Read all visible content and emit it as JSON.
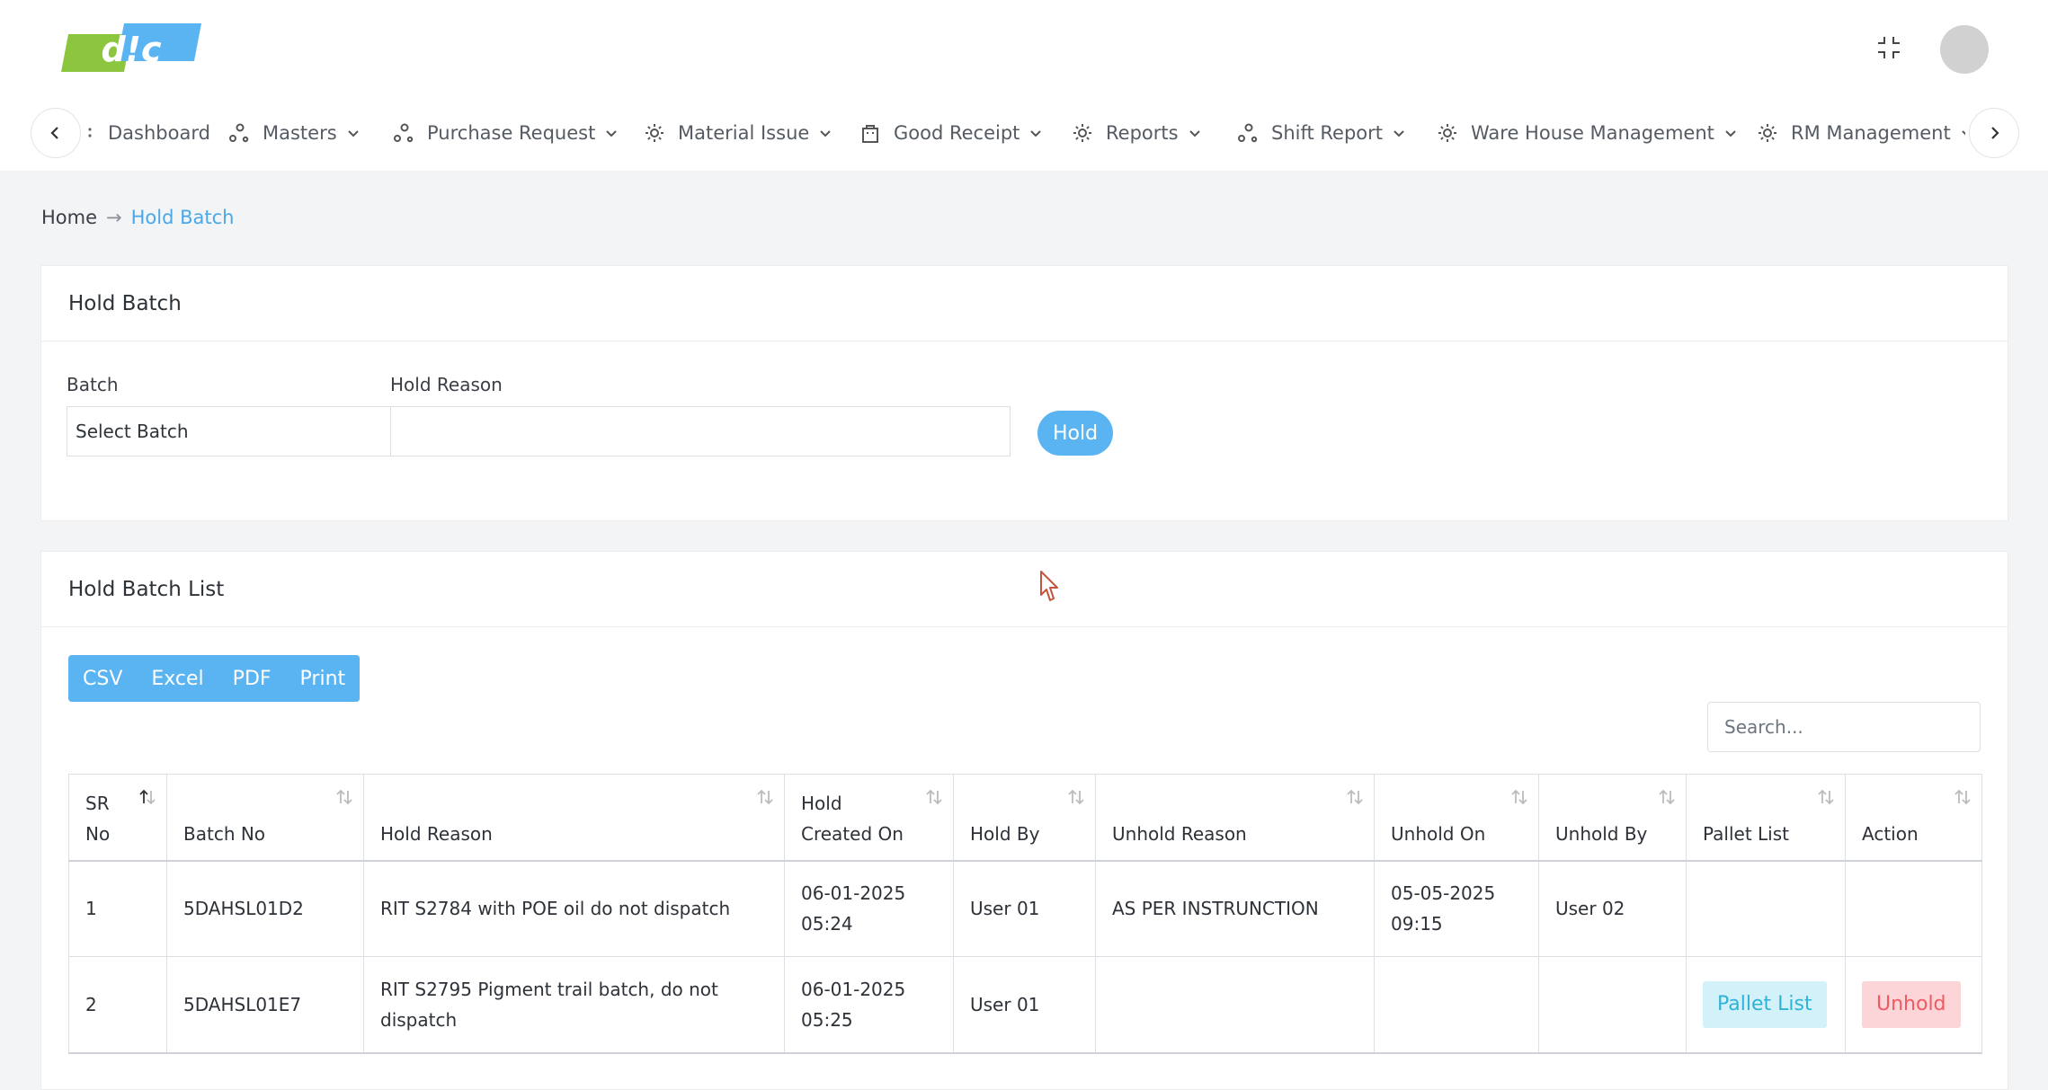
{
  "logo": {
    "text": "d!c",
    "colors": {
      "green": "#8cc63f",
      "blue": "#5ab4f2"
    }
  },
  "header": {
    "fullscreen_icon": "compress-icon",
    "avatar": "user-avatar"
  },
  "nav": {
    "items": [
      {
        "label": "Dashboard",
        "icon": "dashboard-icon"
      },
      {
        "label": "Masters",
        "icon": "nodes-icon"
      },
      {
        "label": "Purchase Request",
        "icon": "nodes-icon"
      },
      {
        "label": "Material Issue",
        "icon": "gear-icon"
      },
      {
        "label": "Good Receipt",
        "icon": "bag-icon"
      },
      {
        "label": "Reports",
        "icon": "gear-icon"
      },
      {
        "label": "Shift Report",
        "icon": "nodes-icon"
      },
      {
        "label": "Ware House Management",
        "icon": "gear-icon"
      },
      {
        "label": "RM Management",
        "icon": "gear-icon"
      }
    ]
  },
  "breadcrumb": {
    "home": "Home",
    "separator": "→",
    "current": "Hold Batch"
  },
  "hold_form": {
    "title": "Hold Batch",
    "batch_label": "Batch",
    "batch_value": "Select Batch",
    "reason_label": "Hold Reason",
    "reason_value": "",
    "reason_placeholder": "",
    "submit_label": "Hold"
  },
  "list": {
    "title": "Hold Batch List",
    "exports": [
      "CSV",
      "Excel",
      "PDF",
      "Print"
    ],
    "search_placeholder": "Search...",
    "columns": [
      "SR\nNo",
      "Batch No",
      "Hold Reason",
      "Hold\nCreated On",
      "Hold By",
      "Unhold Reason",
      "Unhold On",
      "Unhold By",
      "Pallet List",
      "Action"
    ],
    "rows": [
      {
        "sr": "1",
        "batch": "5DAHSL01D2",
        "reason": "RIT S2784 with POE oil do not dispatch",
        "created": "06-01-2025\n05:24",
        "hold_by": "User 01",
        "unhold_reason": "AS PER INSTRUNCTION",
        "unhold_on": "05-05-2025\n09:15",
        "unhold_by": "User 02",
        "pallet": "",
        "action": ""
      },
      {
        "sr": "2",
        "batch": "5DAHSL01E7",
        "reason": "RIT S2795 Pigment trail batch, do not dispatch",
        "created": "06-01-2025\n05:25",
        "hold_by": "User 01",
        "unhold_reason": "",
        "unhold_on": "",
        "unhold_by": "",
        "pallet": "Pallet List",
        "action": "Unhold"
      }
    ]
  }
}
